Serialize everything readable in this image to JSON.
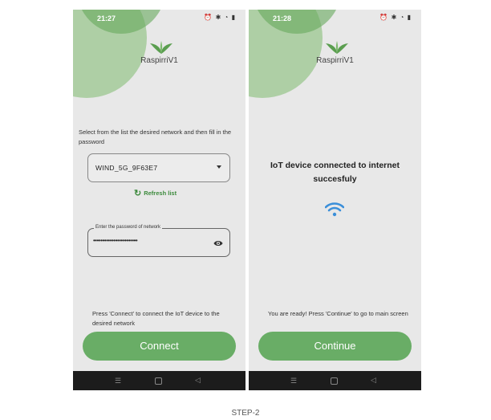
{
  "screen1": {
    "time": "21:27",
    "app_name": "RaspirriV1",
    "instruction": "Select from the list the desired network and then fill in the password",
    "network_selected": "WIND_5G_9F63E7",
    "refresh_label": "Refresh list",
    "password_label": "Enter the password of network",
    "password_value": "••••••••••••••••••••••••",
    "bottom_text": "Press 'Connect' to connect the IoT device to the desired network",
    "button_label": "Connect"
  },
  "screen2": {
    "time": "21:28",
    "app_name": "RaspirriV1",
    "status_message": "IoT device connected to internet succesfuly",
    "bottom_text": "You are ready! Press 'Continue' to go to main screen",
    "button_label": "Continue"
  },
  "caption": "STEP-2",
  "colors": {
    "accent": "#69ad66",
    "background": "#e8e8e8",
    "navbar": "#1c1c1c",
    "wifi": "#3b8fd9"
  },
  "icons": [
    "leaf-logo-icon",
    "dropdown-caret-icon",
    "refresh-icon",
    "eye-icon",
    "wifi-icon"
  ]
}
